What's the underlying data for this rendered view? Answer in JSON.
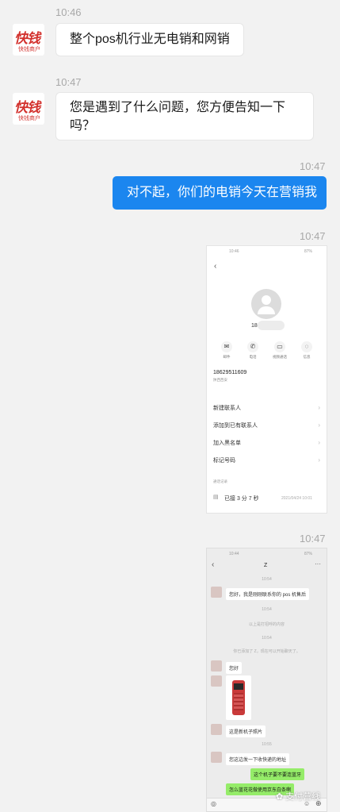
{
  "messages": [
    {
      "time": "10:46",
      "text": "整个pos机行业无电销和网销"
    },
    {
      "time": "10:47",
      "text": "您是遇到了什么问题，您方便告知一下吗？"
    },
    {
      "time": "10:47",
      "text": "对不起，你们的电销今天在营销我"
    },
    {
      "time": "10:47"
    },
    {
      "time": "10:47"
    }
  ],
  "avatar": {
    "brand": "快钱",
    "sub": "快钱商户"
  },
  "contact_shot": {
    "status_time": "10:46",
    "battery": "87%",
    "number_partial": "18",
    "actions": [
      "邮件",
      "电话",
      "视频通话",
      "信息"
    ],
    "phone": "18629511609",
    "phone_sub": "陕西西安",
    "options": [
      "新建联系人",
      "添加到已有联系人",
      "加入黑名单",
      "标记号码"
    ],
    "log_title": "通话记录",
    "log_entry": "已接 3 分 7 秒",
    "log_time": "2021/04/24 10:01"
  },
  "chat_shot": {
    "status_time": "10:44",
    "battery": "87%",
    "title": "Z",
    "times": [
      "10:54",
      "10:54",
      "10:54",
      "10:55"
    ],
    "greeting": "您好，我是刚刚联系你的 pos 机售后",
    "system_1": "以上是打招呼的内容",
    "system_2": "你已添加了 Z，现在可以开始聊天了。",
    "hi": "您好",
    "new_photo": "这是新机子照片",
    "address": "您这边发一下收快递的地址",
    "green_1": "这个机子要不要连蓝牙",
    "green_2": "怎么蓝花花做使用京东白条啊"
  },
  "watermark": "支付营线"
}
